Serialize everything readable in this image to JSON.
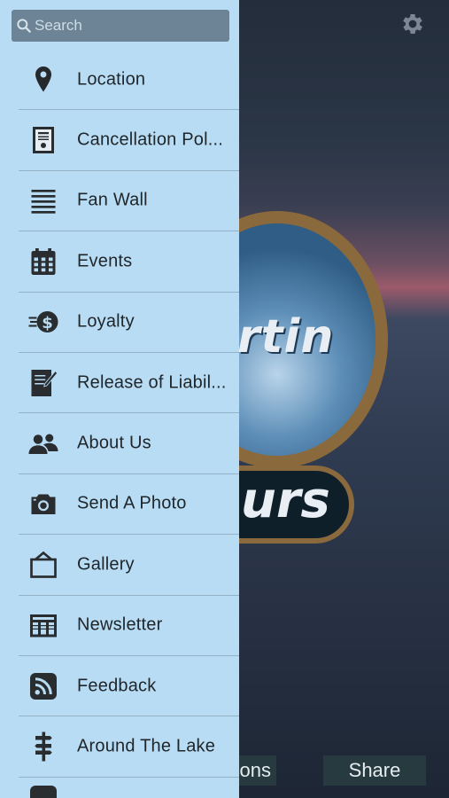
{
  "search": {
    "placeholder": "Search"
  },
  "menu": [
    {
      "label": "Location",
      "icon": "location-pin-icon"
    },
    {
      "label": "Cancellation Pol...",
      "icon": "certificate-icon"
    },
    {
      "label": "Fan Wall",
      "icon": "lines-icon"
    },
    {
      "label": "Events",
      "icon": "calendar-icon"
    },
    {
      "label": "Loyalty",
      "icon": "coin-icon"
    },
    {
      "label": "Release of Liabil...",
      "icon": "document-pen-icon"
    },
    {
      "label": "About Us",
      "icon": "people-icon"
    },
    {
      "label": "Send A Photo",
      "icon": "camera-icon"
    },
    {
      "label": "Gallery",
      "icon": "picture-frame-icon"
    },
    {
      "label": "Newsletter",
      "icon": "newspaper-icon"
    },
    {
      "label": "Feedback",
      "icon": "rss-icon"
    },
    {
      "label": "Around The Lake",
      "icon": "signpost-icon"
    }
  ],
  "background": {
    "logo_top_word": "rtin",
    "logo_bottom_word": "urs",
    "tab_left_label": "ons",
    "tab_right_label": "Share"
  }
}
